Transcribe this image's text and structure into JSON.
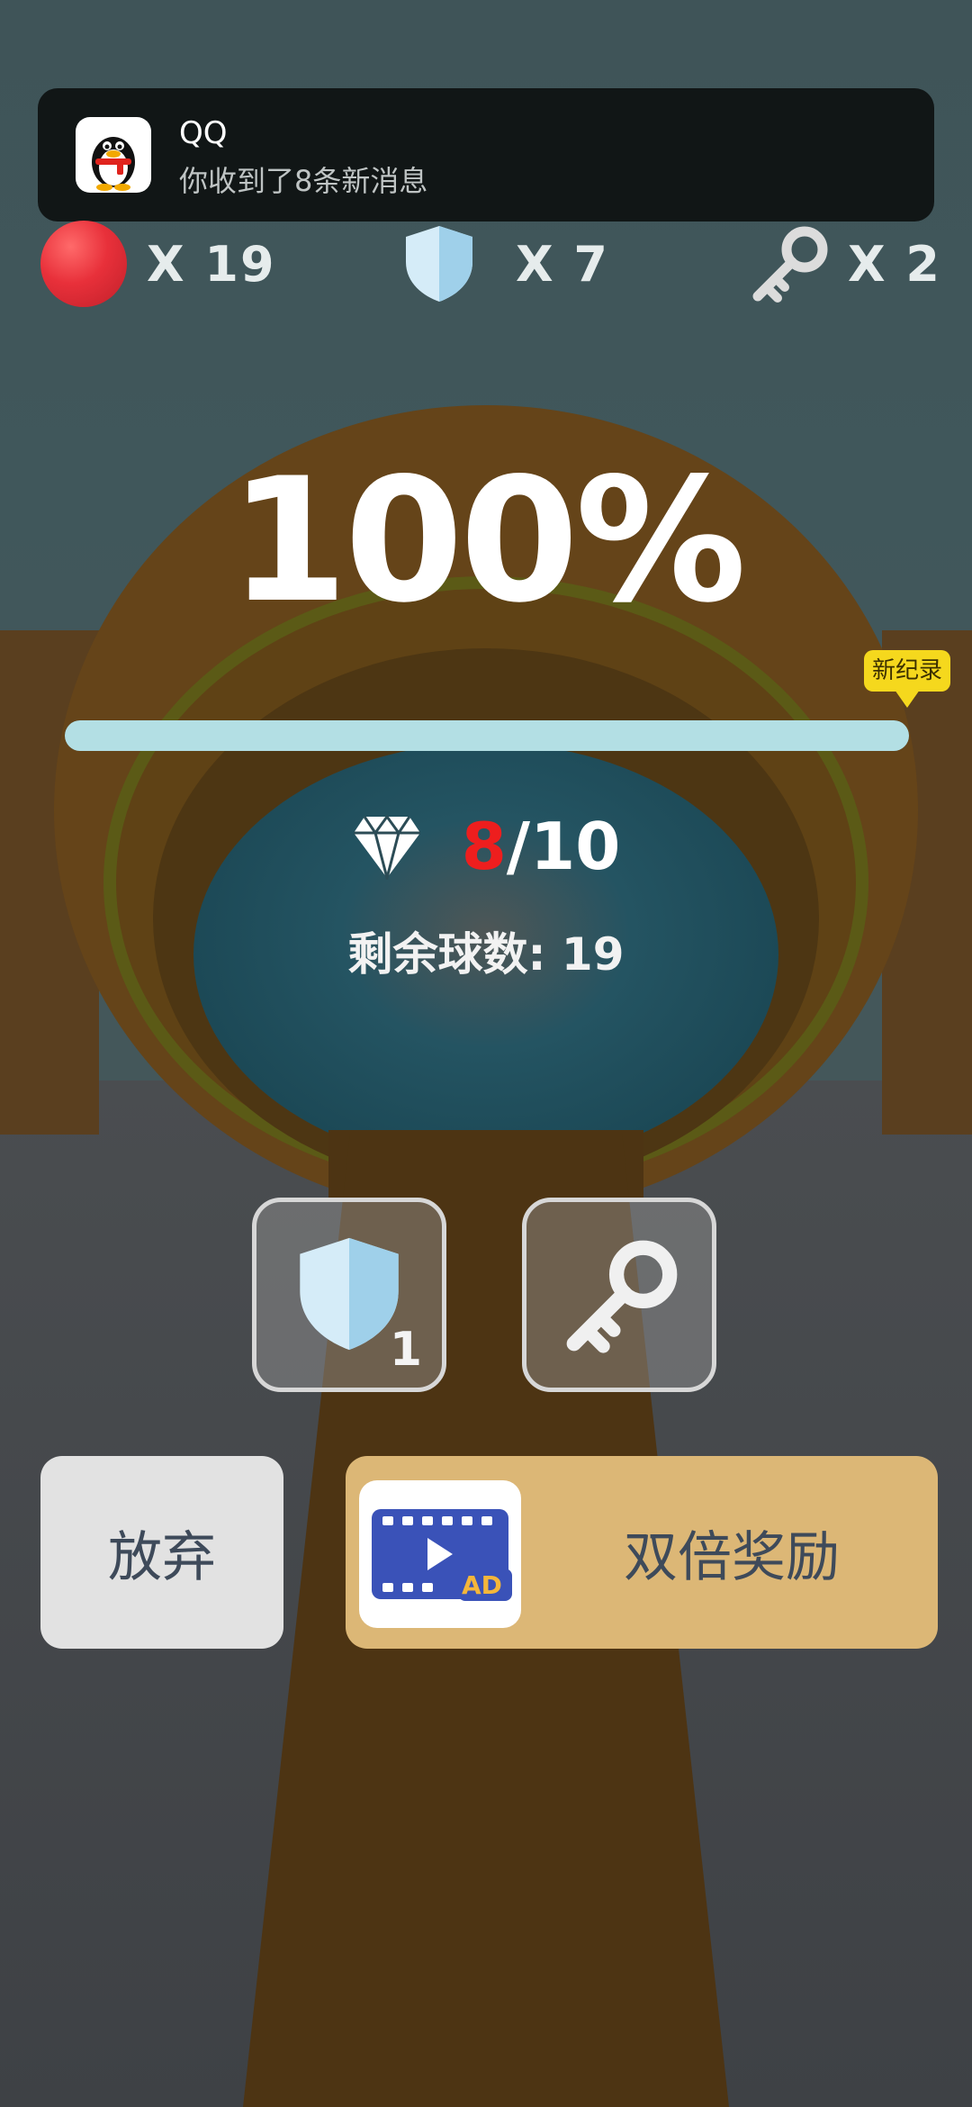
{
  "notification": {
    "app_name": "QQ",
    "message": "你收到了8条新消息",
    "icon": "qq-penguin-icon"
  },
  "counters": {
    "balls": {
      "icon": "red-ball-icon",
      "label": "X 19"
    },
    "shields": {
      "icon": "shield-icon",
      "label": "X 7"
    },
    "keys": {
      "icon": "key-icon",
      "label": "X 2"
    }
  },
  "progress": {
    "percent_text": "100%",
    "fraction": 1.0,
    "record_badge": "新纪录"
  },
  "gems": {
    "icon": "diamond-icon",
    "collected": "8",
    "total_text": "/10"
  },
  "balls_remaining": "剩余球数: 19",
  "items": {
    "shield_slot": {
      "icon": "shield-icon",
      "count": "1"
    },
    "key_slot": {
      "icon": "key-icon"
    }
  },
  "buttons": {
    "give_up": "放弃",
    "double_reward": "双倍奖励",
    "ad_badge": "AD"
  },
  "colors": {
    "ball_red": "#e8303a",
    "progress_fill": "#b3dfe4",
    "gem_current": "#ee1e1e",
    "record_yellow": "#f5d81d",
    "double_button": "#dcb776"
  }
}
